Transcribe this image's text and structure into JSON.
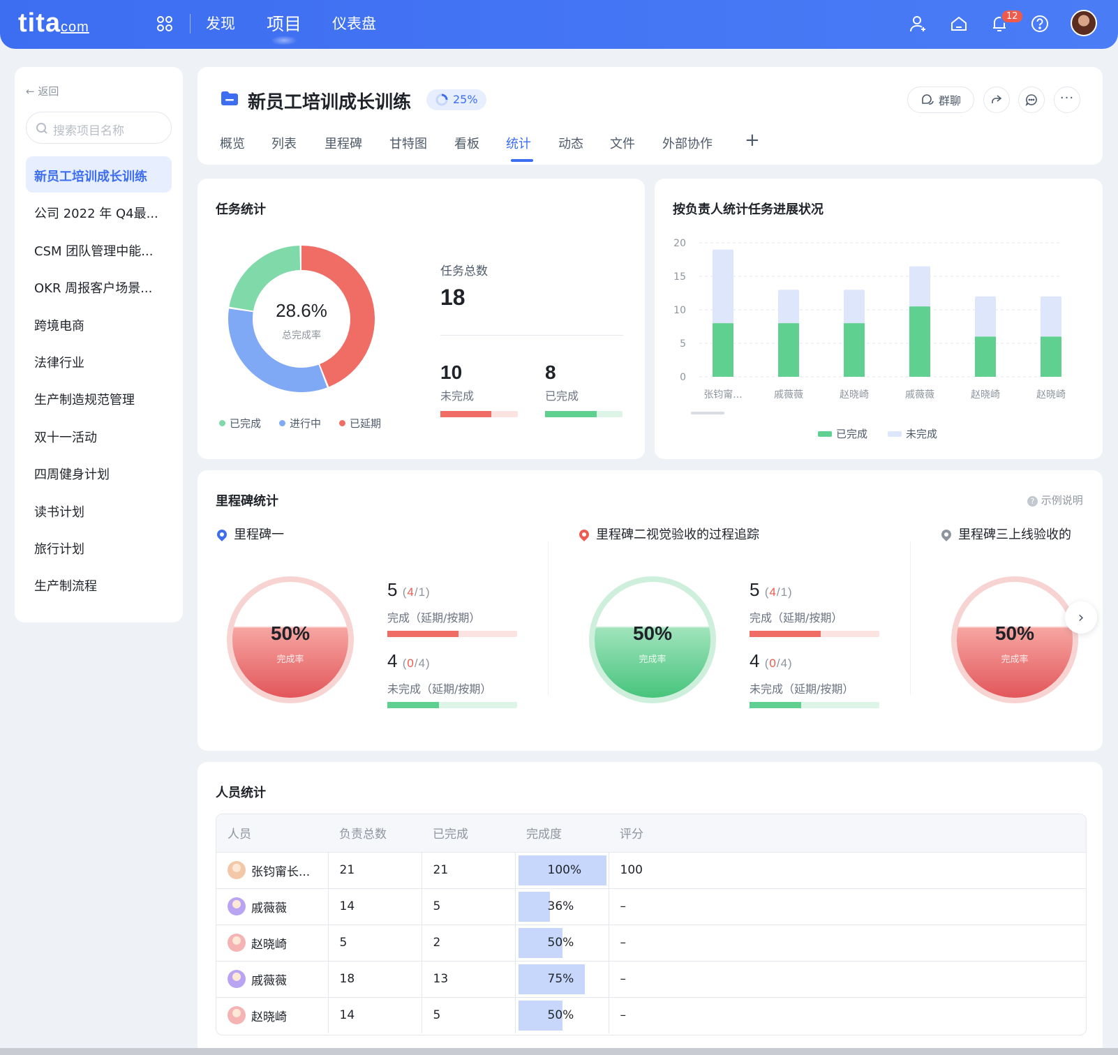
{
  "topbar": {
    "logo": "tita",
    "logo_suffix": "com",
    "nav": [
      "发现",
      "项目",
      "仪表盘"
    ],
    "active_nav": "项目",
    "notification_count": "12"
  },
  "sidebar": {
    "back_label": "返回",
    "search_placeholder": "搜索项目名称",
    "items": [
      {
        "label": "新员工培训成长训练",
        "active": true
      },
      {
        "label": "公司 2022 年 Q4最..."
      },
      {
        "label": "CSM 团队管理中能..."
      },
      {
        "label": "OKR 周报客户场景..."
      },
      {
        "label": "跨境电商"
      },
      {
        "label": "法律行业"
      },
      {
        "label": "生产制造规范管理"
      },
      {
        "label": "双十一活动"
      },
      {
        "label": "四周健身计划"
      },
      {
        "label": "读书计划"
      },
      {
        "label": "旅行计划"
      },
      {
        "label": "生产制流程"
      }
    ]
  },
  "project": {
    "title": "新员工培训成长训练",
    "progress": "25%",
    "group_chat": "群聊",
    "tabs": [
      "概览",
      "列表",
      "里程碑",
      "甘特图",
      "看板",
      "统计",
      "动态",
      "文件",
      "外部协作"
    ],
    "active_tab": "统计"
  },
  "task_stats": {
    "title": "任务统计",
    "rate": "28.6%",
    "rate_label": "总完成率",
    "total_label": "任务总数",
    "total": "18",
    "unfinished": "10",
    "unfinished_label": "未完成",
    "finished": "8",
    "finished_label": "已完成",
    "legend": [
      "已完成",
      "进行中",
      "已延期"
    ],
    "colors": {
      "done": "#7fd9a8",
      "doing": "#7fa8f5",
      "delayed": "#ef6d65"
    }
  },
  "chart_data": {
    "type": "bar",
    "title": "按负责人统计任务进展状况",
    "categories": [
      "张钧甯...",
      "戚薇薇",
      "赵晓崎",
      "戚薇薇",
      "赵晓崎",
      "赵晓崎"
    ],
    "series": [
      {
        "name": "已完成",
        "values": [
          8,
          8,
          8,
          10.5,
          6,
          6
        ],
        "color": "#5fd08f"
      },
      {
        "name": "未完成",
        "values": [
          11,
          5,
          5,
          6,
          6,
          6
        ],
        "color": "#dde6fb"
      }
    ],
    "ylim": [
      0,
      20
    ],
    "yticks": [
      0,
      5,
      10,
      15,
      20
    ],
    "stacked": true,
    "legend_position": "bottom"
  },
  "milestones": {
    "title": "里程碑统计",
    "help": "示例说明",
    "items": [
      {
        "name": "里程碑一",
        "pin_color": "#3d6df1",
        "theme": "red",
        "pct": "50%",
        "pct_label": "完成率",
        "done": "5",
        "done_delay": "4",
        "done_ontime": "1",
        "done_label": "完成（延期/按期）",
        "undone": "4",
        "undone_delay": "0",
        "undone_ontime": "4",
        "undone_label": "未完成（延期/按期）"
      },
      {
        "name": "里程碑二视觉验收的过程追踪",
        "pin_color": "#ef5b52",
        "theme": "green",
        "pct": "50%",
        "pct_label": "完成率",
        "done": "5",
        "done_delay": "4",
        "done_ontime": "1",
        "done_label": "完成（延期/按期）",
        "undone": "4",
        "undone_delay": "0",
        "undone_ontime": "4",
        "undone_label": "未完成（延期/按期）"
      },
      {
        "name": "里程碑三上线验收的",
        "pin_color": "#8f959e",
        "theme": "red",
        "pct": "50%",
        "pct_label": "完成率"
      }
    ]
  },
  "people": {
    "title": "人员统计",
    "headers": [
      "人员",
      "负责总数",
      "已完成",
      "完成度",
      "评分"
    ],
    "rows": [
      {
        "name": "张钧甯长...",
        "total": "21",
        "done": "21",
        "pct": "100%",
        "pct_value": 1.0,
        "score": "100",
        "avatar": "#f2c8a8"
      },
      {
        "name": "戚薇薇",
        "total": "14",
        "done": "5",
        "pct": "36%",
        "pct_value": 0.36,
        "score": "–",
        "avatar": "#b9a4f2"
      },
      {
        "name": "赵晓崎",
        "total": "5",
        "done": "2",
        "pct": "50%",
        "pct_value": 0.5,
        "score": "–",
        "avatar": "#f6b3b3"
      },
      {
        "name": "戚薇薇",
        "total": "18",
        "done": "13",
        "pct": "75%",
        "pct_value": 0.75,
        "score": "–",
        "avatar": "#b9a4f2"
      },
      {
        "name": "赵晓崎",
        "total": "14",
        "done": "5",
        "pct": "50%",
        "pct_value": 0.5,
        "score": "–",
        "avatar": "#f6b3b3"
      }
    ]
  }
}
